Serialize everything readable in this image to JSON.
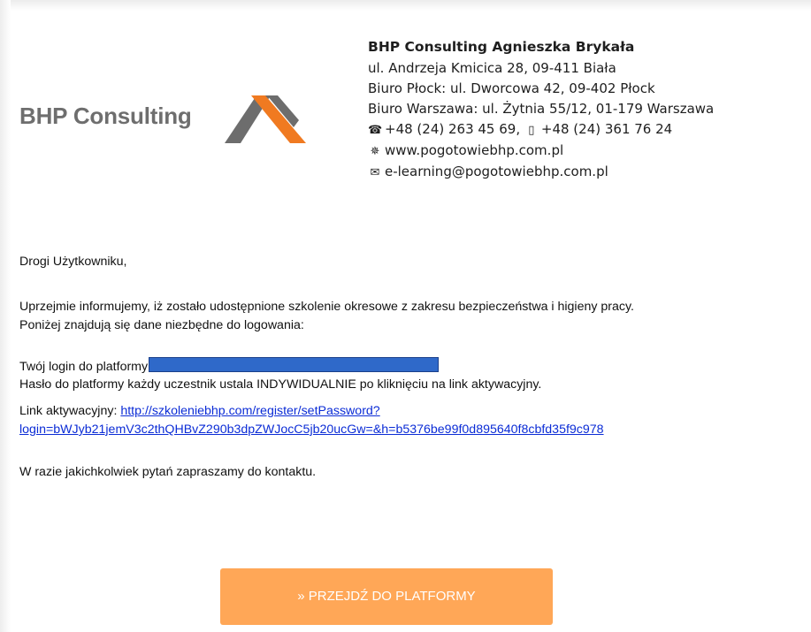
{
  "logo": {
    "text": "BHP Consulting",
    "colors": {
      "text": "#6e6e6e",
      "dark": "#6d6d6d",
      "accent": "#f07a21"
    }
  },
  "company": {
    "name": "BHP Consulting Agnieszka Brykała",
    "address": "ul. Andrzeja Kmicica 28, 09-411 Biała",
    "office_plock": "Biuro Płock: ul. Dworcowa 42, 09-402 Płock",
    "office_warsaw": "Biuro Warszawa: ul. Żytnia 55/12, 01-179 Warszawa",
    "phone1": "+48 (24) 263 45 69,",
    "phone2": "+48 (24) 361 76 24",
    "website": "www.pogotowiebhp.com.pl",
    "email": "e-learning@pogotowiebhp.com.pl",
    "icons": {
      "phone": "☎",
      "fax": "▯",
      "web": "✵",
      "mail": "✉"
    }
  },
  "message": {
    "greeting": "Drogi Użytkowniku,",
    "intro_1": "Uprzejmie informujemy, iż zostało udostępnione szkolenie okresowe z zakresu bezpieczeństwa i higieny pracy.",
    "intro_2": "Poniżej znajdują się dane niezbędne do logowania:",
    "login_label": "Twój login do platformy",
    "password_info": "Hasło do platformy każdy uczestnik ustala INDYWIDUALNIE po kliknięciu na link aktywacyjny.",
    "activation_label": "Link aktywacyjny: ",
    "activation_link_1": "http://szkoleniebhp.com/register/setPassword?",
    "activation_link_2": "login=bWJyb21jemV3c2thQHBvZ290b3dpZWJocC5jb20ucGw=&h=b5376be99f0d895640f8cbfd35f9c978",
    "closing": "W razie jakichkolwiek pytań zapraszamy do kontaktu."
  },
  "cta": {
    "label": "» PRZEJDŹ DO PLATFORMY",
    "color": "#ffa757"
  }
}
